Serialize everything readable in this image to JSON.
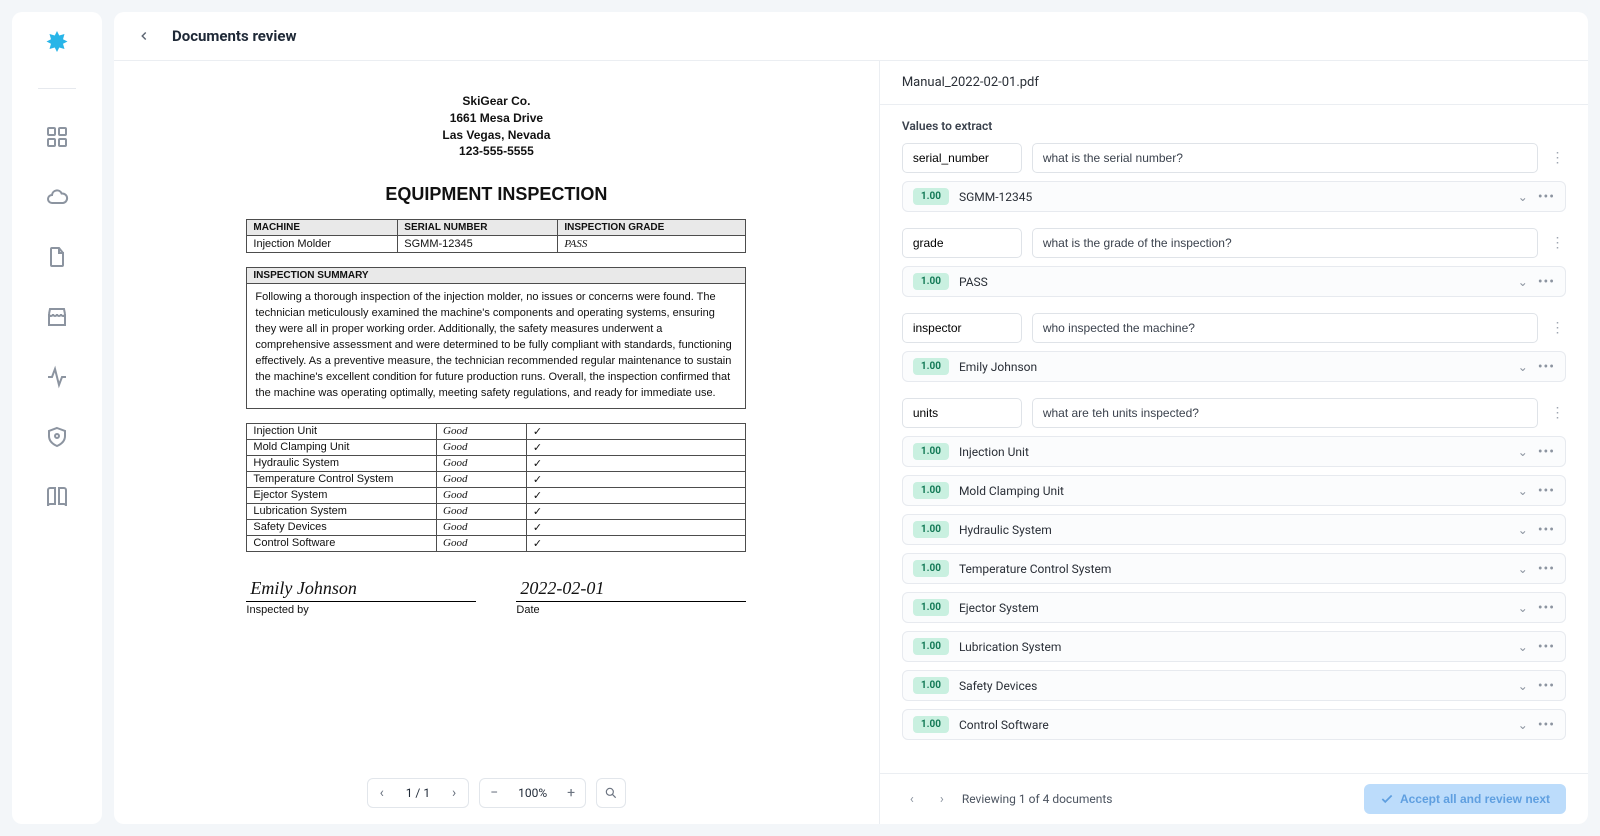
{
  "header": {
    "title": "Documents review"
  },
  "document": {
    "org": [
      "SkiGear Co.",
      "1661 Mesa Drive",
      "Las Vegas, Nevada",
      "123-555-5555"
    ],
    "title": "EQUIPMENT INSPECTION",
    "table1_headers": [
      "MACHINE",
      "SERIAL NUMBER",
      "INSPECTION GRADE"
    ],
    "table1_row": [
      "Injection Molder",
      "SGMM-12345",
      "PASS"
    ],
    "summary_label": "INSPECTION SUMMARY",
    "summary": "Following a thorough inspection of the injection molder, no issues or concerns were found. The technician meticulously examined the machine's components and operating systems, ensuring they were all in proper working order. Additionally, the safety measures underwent a comprehensive assessment and were determined to be fully compliant with standards, functioning effectively. As a preventive measure, the technician recommended regular maintenance to sustain the machine's excellent condition for future production runs. Overall, the inspection confirmed that the machine was operating optimally, meeting safety regulations, and ready for immediate use.",
    "checks": [
      {
        "name": "Injection Unit",
        "rating": "Good"
      },
      {
        "name": "Mold Clamping Unit",
        "rating": "Good"
      },
      {
        "name": "Hydraulic System",
        "rating": "Good"
      },
      {
        "name": "Temperature Control System",
        "rating": "Good"
      },
      {
        "name": "Ejector System",
        "rating": "Good"
      },
      {
        "name": "Lubrication System",
        "rating": "Good"
      },
      {
        "name": "Safety Devices",
        "rating": "Good"
      },
      {
        "name": "Control Software",
        "rating": "Good"
      }
    ],
    "inspected_by": "Emily Johnson",
    "inspected_by_label": "Inspected by",
    "date": "2022-02-01",
    "date_label": "Date"
  },
  "controls": {
    "page": "1 / 1",
    "zoom": "100%"
  },
  "file_name": "Manual_2022-02-01.pdf",
  "section_label": "Values to extract",
  "fields": [
    {
      "name": "serial_number",
      "question": "what is the serial number?",
      "values": [
        {
          "conf": "1.00",
          "text": "SGMM-12345"
        }
      ]
    },
    {
      "name": "grade",
      "question": "what is the grade of the inspection?",
      "values": [
        {
          "conf": "1.00",
          "text": "PASS"
        }
      ]
    },
    {
      "name": "inspector",
      "question": "who inspected the machine?",
      "values": [
        {
          "conf": "1.00",
          "text": "Emily Johnson"
        }
      ]
    },
    {
      "name": "units",
      "question": "what are teh units inspected?",
      "values": [
        {
          "conf": "1.00",
          "text": "Injection Unit"
        },
        {
          "conf": "1.00",
          "text": "Mold Clamping Unit"
        },
        {
          "conf": "1.00",
          "text": "Hydraulic System"
        },
        {
          "conf": "1.00",
          "text": "Temperature Control System"
        },
        {
          "conf": "1.00",
          "text": "Ejector System"
        },
        {
          "conf": "1.00",
          "text": "Lubrication System"
        },
        {
          "conf": "1.00",
          "text": "Safety Devices"
        },
        {
          "conf": "1.00",
          "text": "Control Software"
        }
      ]
    }
  ],
  "footer": {
    "reviewing": "Reviewing 1 of 4 documents",
    "accept": "Accept all and review next"
  }
}
